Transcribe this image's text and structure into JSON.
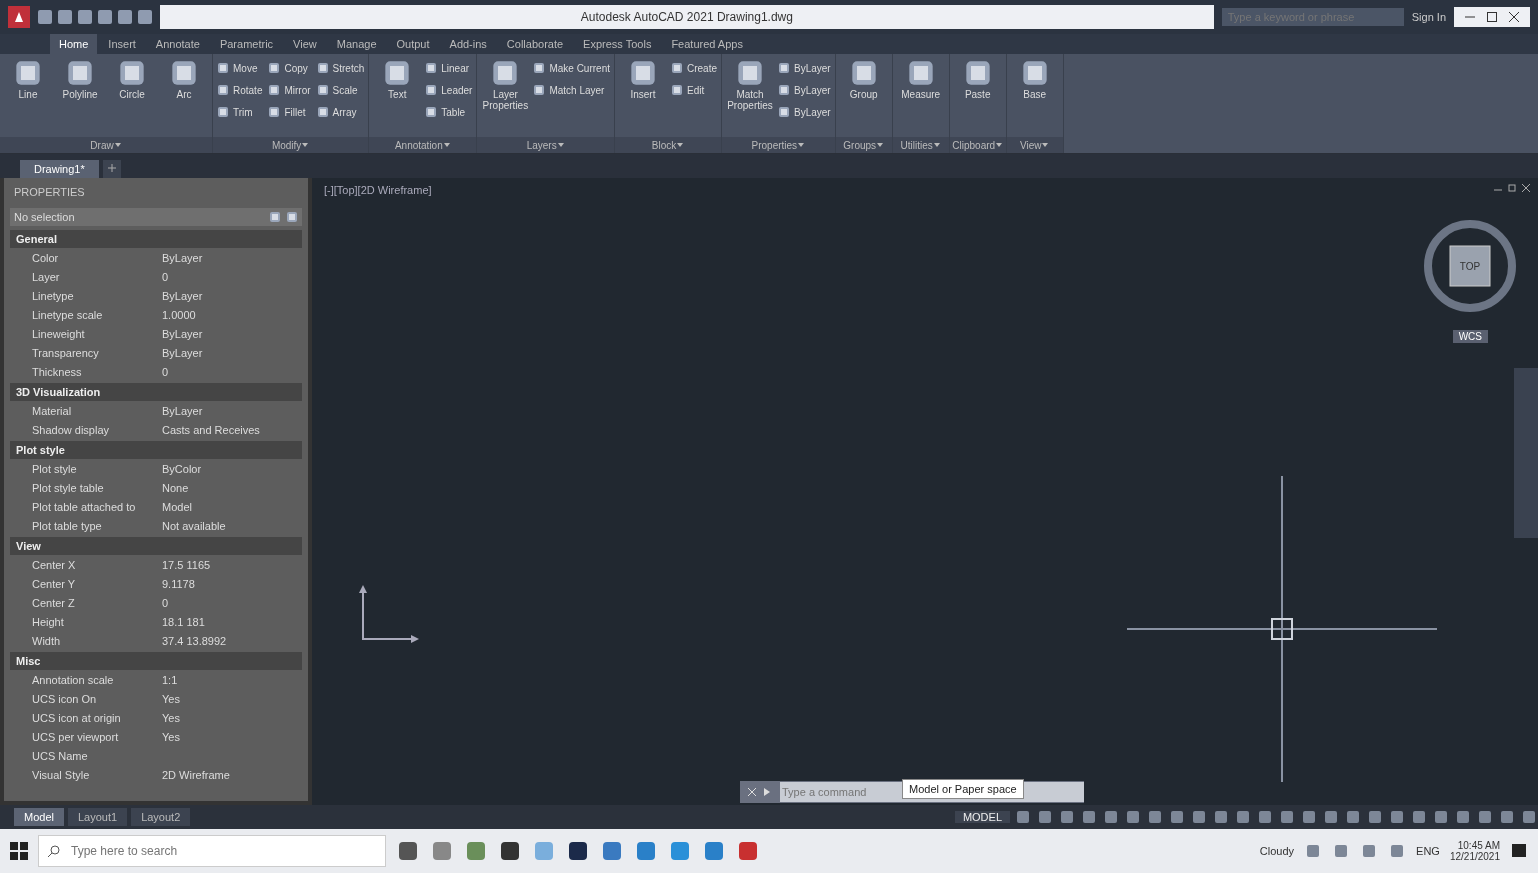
{
  "window": {
    "title": "Autodesk AutoCAD 2021  Drawing1.dwg",
    "search_placeholder": "Type a keyword or phrase",
    "user": "Sign In"
  },
  "tabs": [
    {
      "label": "Home",
      "selected": true
    },
    {
      "label": "Insert",
      "selected": false
    },
    {
      "label": "Annotate",
      "selected": false
    },
    {
      "label": "Parametric",
      "selected": false
    },
    {
      "label": "View",
      "selected": false
    },
    {
      "label": "Manage",
      "selected": false
    },
    {
      "label": "Output",
      "selected": false
    },
    {
      "label": "Add-ins",
      "selected": false
    },
    {
      "label": "Collaborate",
      "selected": false
    },
    {
      "label": "Express Tools",
      "selected": false
    },
    {
      "label": "Featured Apps",
      "selected": false
    }
  ],
  "ribbon": [
    {
      "title": "Draw",
      "large": [
        "Line",
        "Polyline",
        "Circle",
        "Arc"
      ]
    },
    {
      "title": "Modify",
      "small": [
        "Move",
        "Rotate",
        "Trim",
        "Copy",
        "Mirror",
        "Fillet",
        "Stretch",
        "Scale",
        "Array"
      ]
    },
    {
      "title": "Annotation",
      "large": [
        "Text"
      ],
      "small": [
        "Linear",
        "Leader",
        "Table"
      ]
    },
    {
      "title": "Layers",
      "large": [
        "Layer Properties"
      ],
      "small": [
        "Make Current",
        "Match Layer"
      ]
    },
    {
      "title": "Block",
      "large": [
        "Insert"
      ],
      "small": [
        "Create",
        "Edit"
      ]
    },
    {
      "title": "Properties",
      "large": [
        "Match Properties"
      ],
      "small": [
        "ByLayer",
        "ByLayer",
        "ByLayer"
      ]
    },
    {
      "title": "Groups",
      "large": [
        "Group"
      ]
    },
    {
      "title": "Utilities",
      "large": [
        "Measure"
      ]
    },
    {
      "title": "Clipboard",
      "large": [
        "Paste"
      ]
    },
    {
      "title": "View",
      "large": [
        "Base"
      ]
    }
  ],
  "doc_tabs": [
    {
      "label": "Drawing1*",
      "selected": true
    }
  ],
  "properties": {
    "title": "PROPERTIES",
    "selection": "No selection",
    "sections": [
      {
        "title": "General",
        "rows": [
          {
            "label": "Color",
            "value": "ByLayer"
          },
          {
            "label": "Layer",
            "value": "0"
          },
          {
            "label": "Linetype",
            "value": "ByLayer"
          },
          {
            "label": "Linetype scale",
            "value": "1.0000"
          },
          {
            "label": "Lineweight",
            "value": "ByLayer"
          },
          {
            "label": "Transparency",
            "value": "ByLayer"
          },
          {
            "label": "Thickness",
            "value": "0"
          }
        ]
      },
      {
        "title": "3D Visualization",
        "rows": [
          {
            "label": "Material",
            "value": "ByLayer"
          },
          {
            "label": "Shadow display",
            "value": "Casts and Receives"
          }
        ]
      },
      {
        "title": "Plot style",
        "rows": [
          {
            "label": "Plot style",
            "value": "ByColor"
          },
          {
            "label": "Plot style table",
            "value": "None"
          },
          {
            "label": "Plot table attached to",
            "value": "Model"
          },
          {
            "label": "Plot table type",
            "value": "Not available"
          }
        ]
      },
      {
        "title": "View",
        "rows": [
          {
            "label": "Center X",
            "value": "17.5 1165"
          },
          {
            "label": "Center Y",
            "value": "9.1178"
          },
          {
            "label": "Center Z",
            "value": "0"
          },
          {
            "label": "Height",
            "value": "18.1 181"
          },
          {
            "label": "Width",
            "value": "37.4 13.8992"
          }
        ]
      },
      {
        "title": "Misc",
        "rows": [
          {
            "label": "Annotation scale",
            "value": "1:1"
          },
          {
            "label": "UCS icon On",
            "value": "Yes"
          },
          {
            "label": "UCS icon at origin",
            "value": "Yes"
          },
          {
            "label": "UCS per viewport",
            "value": "Yes"
          },
          {
            "label": "UCS Name"
          },
          {
            "label": "Visual Style",
            "value": "2D Wireframe"
          }
        ]
      }
    ]
  },
  "viewport": {
    "label": "[-][Top][2D Wireframe]",
    "viewcube": "TOP",
    "wcs": "WCS"
  },
  "command": {
    "placeholder": "Type a command",
    "tooltip": "Model or Paper space"
  },
  "layouts": [
    {
      "label": "Model",
      "selected": true
    },
    {
      "label": "Layout1",
      "selected": false
    },
    {
      "label": "Layout2",
      "selected": false
    }
  ],
  "status": {
    "mode": "MODEL"
  },
  "taskbar": {
    "search_placeholder": "Type here to search",
    "weather": "Cloudy",
    "lang": "ENG",
    "time": "10:45 AM",
    "date": "12/21/2021"
  }
}
